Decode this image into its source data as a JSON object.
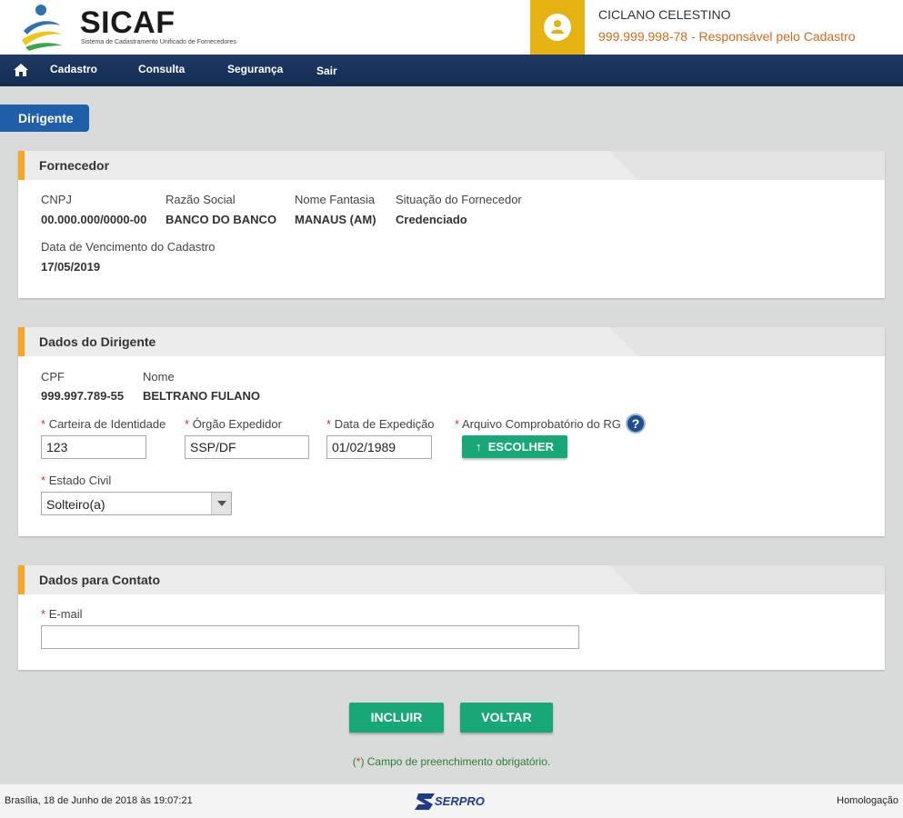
{
  "header": {
    "logo_title": "SICAF",
    "logo_subtitle": "Sistema de Cadastramento Unificado de Fornecedores",
    "user_name": "CICLANO CELESTINO",
    "user_role": "999.999.998-78 - Responsável pelo Cadastro",
    "accent_color": "#e5b212"
  },
  "nav": {
    "home_icon": "home-icon",
    "items": [
      "Cadastro",
      "Consulta",
      "Segurança",
      "Sair"
    ]
  },
  "page_tab": "Dirigente",
  "fornecedor": {
    "title": "Fornecedor",
    "cnpj_label": "CNPJ",
    "cnpj_value": "00.000.000/0000-00",
    "razao_label": "Razão Social",
    "razao_value": "BANCO DO BANCO",
    "fantasia_label": "Nome Fantasia",
    "fantasia_value": "MANAUS (AM)",
    "situacao_label": "Situação do Fornecedor",
    "situacao_value": "Credenciado",
    "vencimento_label": "Data de Vencimento do Cadastro",
    "vencimento_value": "17/05/2019"
  },
  "dirigente": {
    "title": "Dados do Dirigente",
    "cpf_label": "CPF",
    "cpf_value": "999.997.789-55",
    "nome_label": "Nome",
    "nome_value": "BELTRANO FULANO",
    "identidade_label": "Carteira de Identidade",
    "identidade_value": "123",
    "orgao_label": "Órgão Expedidor",
    "orgao_value": "SSP/DF",
    "expedicao_label": "Data de Expedição",
    "expedicao_value": "01/02/1989",
    "arquivo_label": "Arquivo Comprobatório do RG",
    "help_glyph": "?",
    "escolher_label": "ESCOLHER",
    "escolher_icon": "↑",
    "estado_civil_label": "Estado Civil",
    "estado_civil_value": "Solteiro(a)"
  },
  "contato": {
    "title": "Dados para Contato",
    "email_label": "E-mail",
    "email_value": ""
  },
  "actions": {
    "incluir": "INCLUIR",
    "voltar": "VOLTAR"
  },
  "required_marker": "*",
  "required_note_open": "(",
  "required_note_star": "*",
  "required_note_text": ") Campo de preenchimento obrigatório.",
  "footer": {
    "datetime": "Brasília, 18 de Junho de 2018 às 19:07:21",
    "brand": "SERPRO",
    "environment": "Homologação"
  }
}
